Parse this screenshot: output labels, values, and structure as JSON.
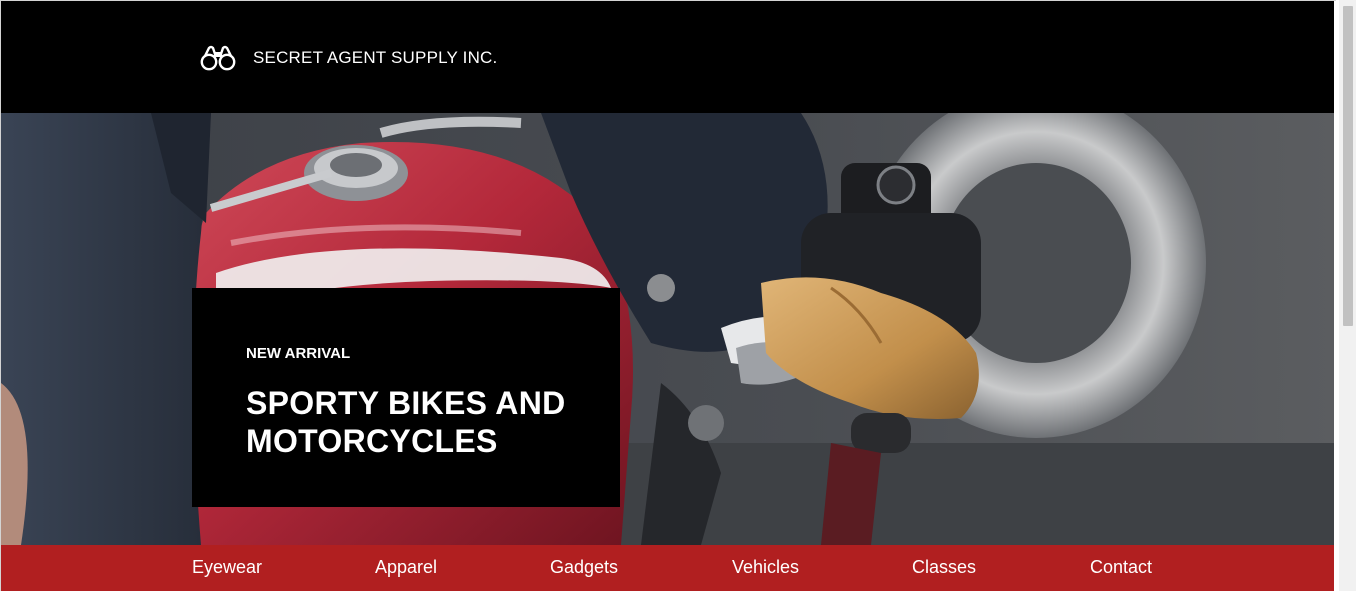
{
  "header": {
    "brand_name": "SECRET AGENT SUPPLY INC.",
    "brand_icon": "binoculars-icon"
  },
  "hero": {
    "image": "motorcycle-rider-photo",
    "eyebrow": "NEW ARRIVAL",
    "title": "SPORTY BIKES AND MOTORCYCLES"
  },
  "nav": {
    "items": [
      {
        "label": "Eyewear"
      },
      {
        "label": "Apparel"
      },
      {
        "label": "Gadgets"
      },
      {
        "label": "Vehicles"
      },
      {
        "label": "Classes"
      },
      {
        "label": "Contact"
      }
    ]
  },
  "colors": {
    "header_bg": "#000000",
    "nav_bg": "#b11f20",
    "promo_bg": "#000000",
    "text": "#ffffff"
  }
}
